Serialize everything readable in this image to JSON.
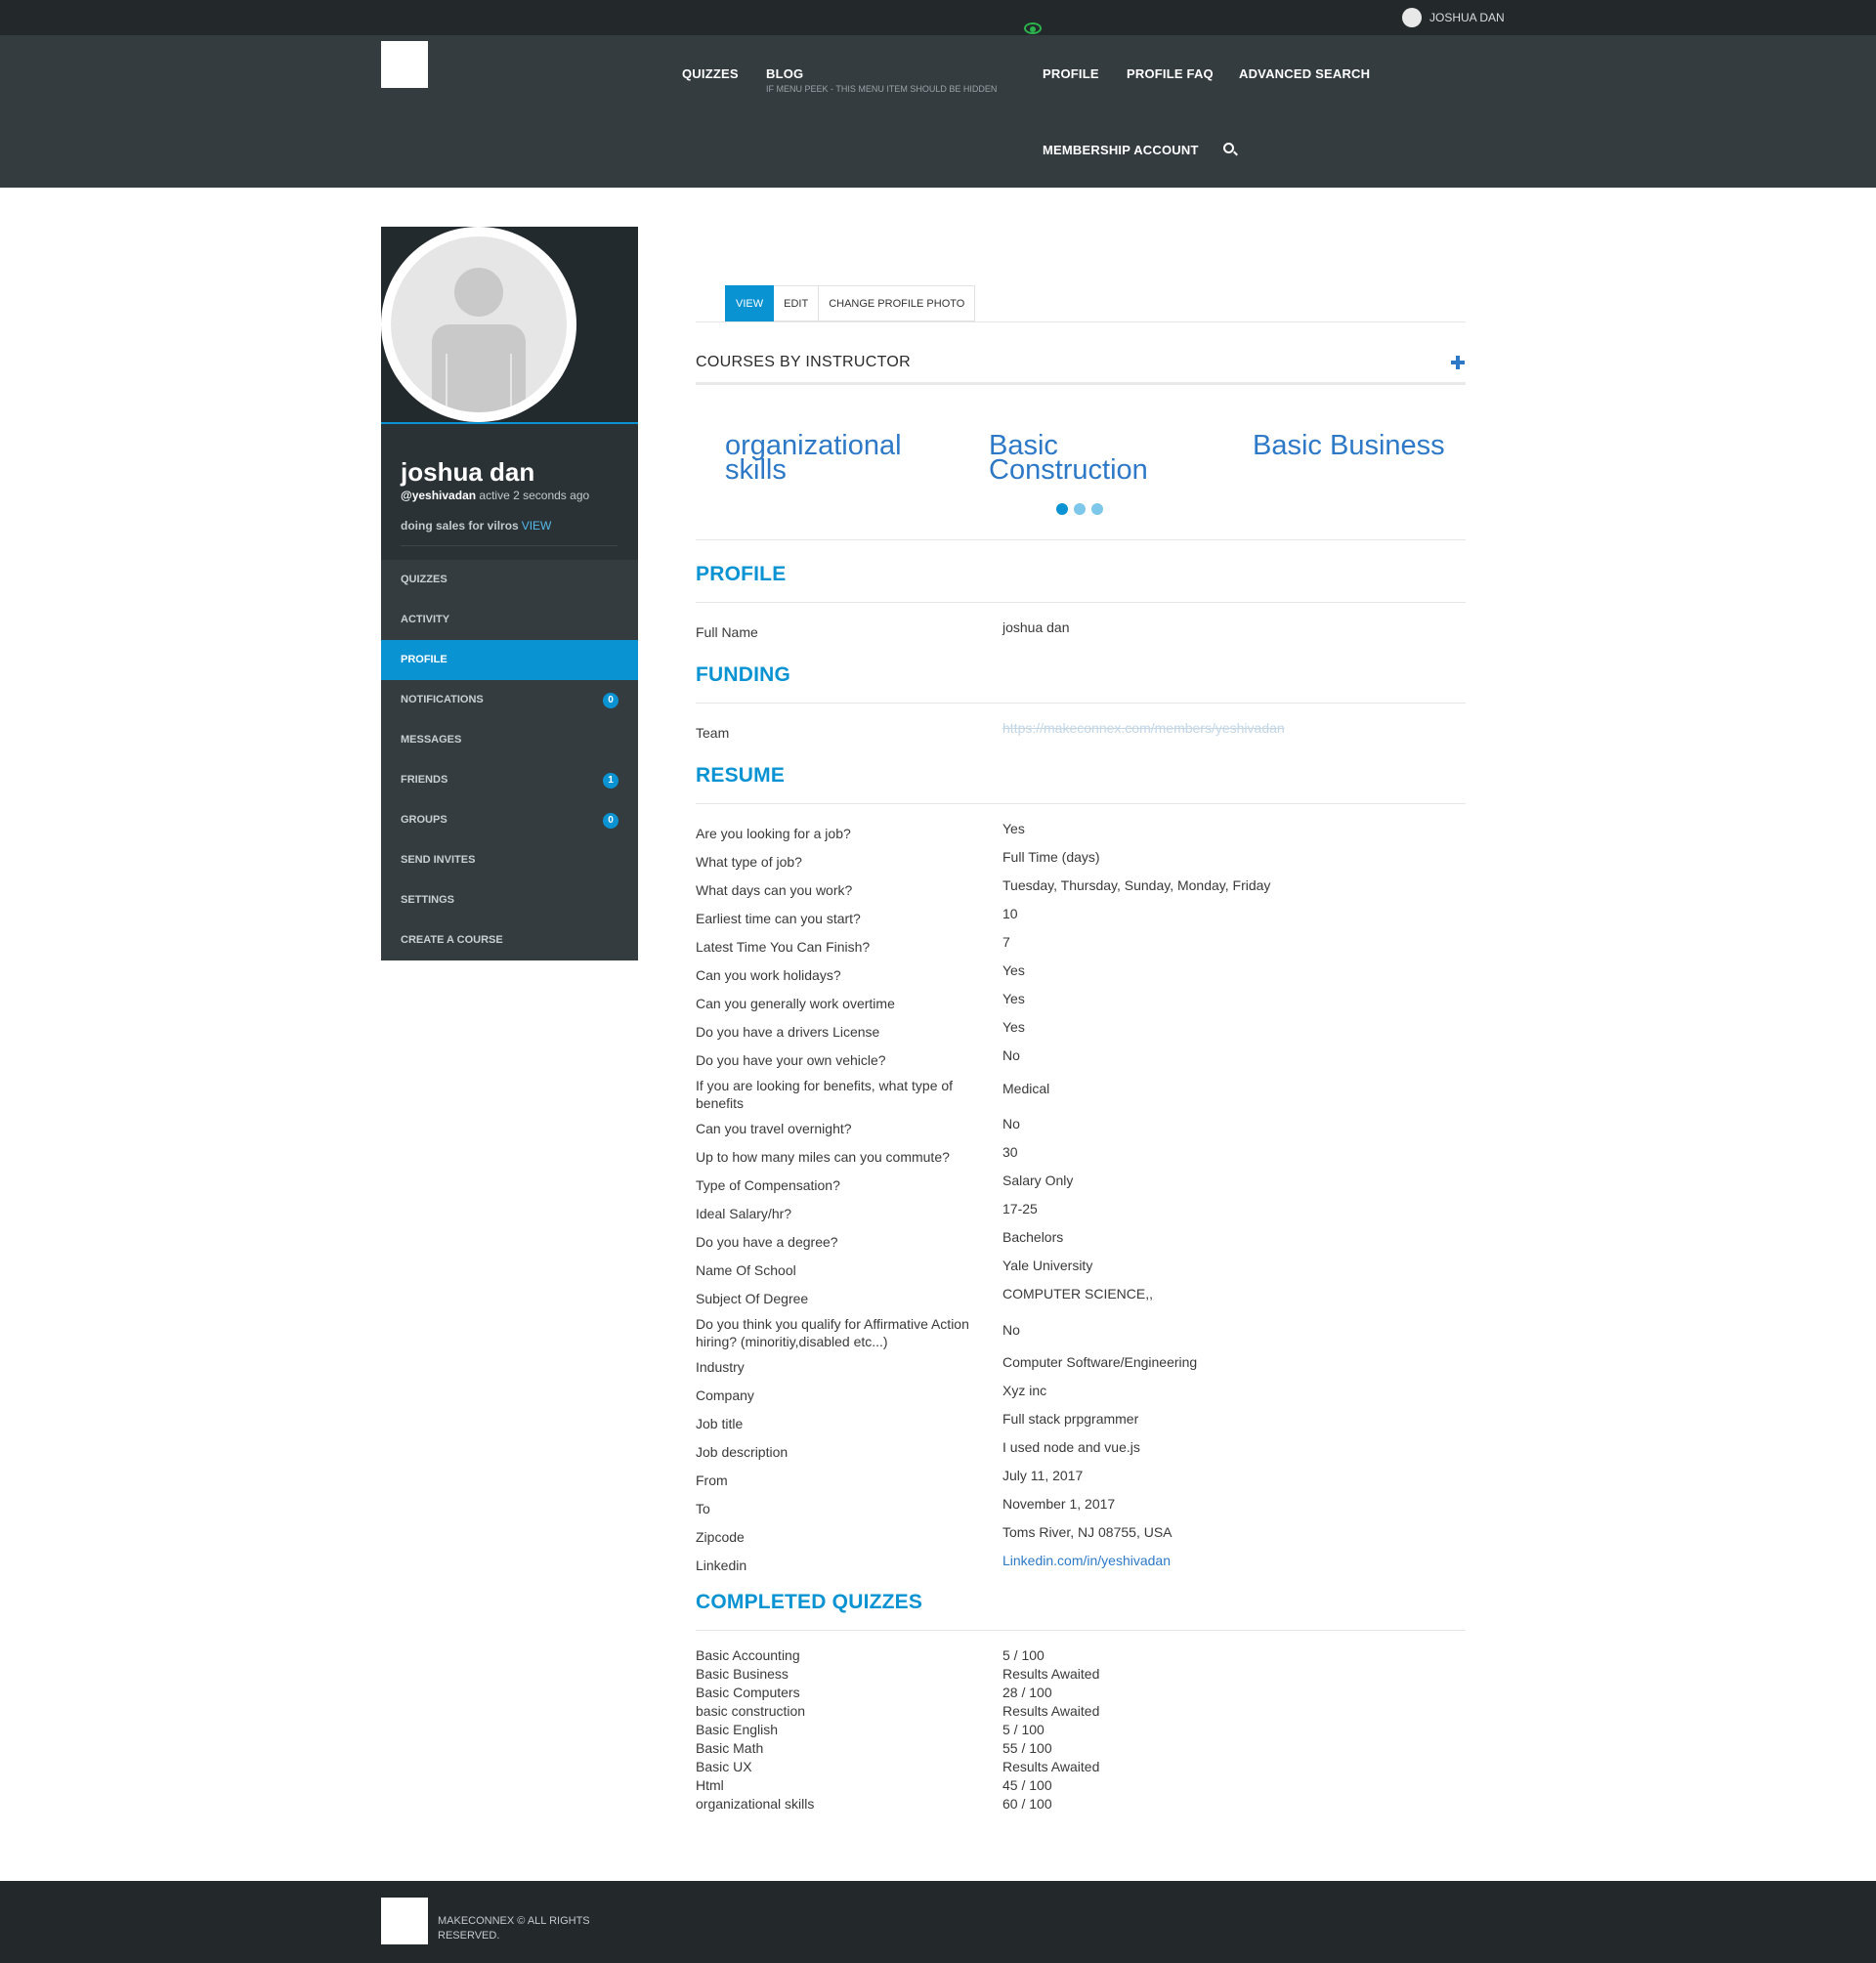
{
  "adminbar": {
    "user_name": "JOSHUA DAN"
  },
  "nav": {
    "quizzes": "QUIZZES",
    "blog": "BLOG",
    "blog_sub": "IF MENU PEEK - THIS MENU ITEM SHOULD BE HIDDEN",
    "profile": "PROFILE",
    "profile_faq": "PROFILE FAQ",
    "advanced_search": "ADVANCED SEARCH",
    "membership_account": "MEMBERSHIP ACCOUNT"
  },
  "user": {
    "name": "joshua dan",
    "handle": "@yeshivadan",
    "active": "active 2 seconds ago",
    "status": "doing sales for vilros",
    "status_view": "VIEW"
  },
  "menu": [
    {
      "label": "QUIZZES"
    },
    {
      "label": "ACTIVITY"
    },
    {
      "label": "PROFILE"
    },
    {
      "label": "NOTIFICATIONS",
      "badge": "0"
    },
    {
      "label": "MESSAGES"
    },
    {
      "label": "FRIENDS",
      "badge": "1"
    },
    {
      "label": "GROUPS",
      "badge": "0"
    },
    {
      "label": "SEND INVITES"
    },
    {
      "label": "SETTINGS"
    },
    {
      "label": "CREATE A COURSE"
    }
  ],
  "tabs": [
    "VIEW",
    "EDIT",
    "CHANGE PROFILE PHOTO"
  ],
  "courses": {
    "title": "COURSES BY INSTRUCTOR",
    "items": [
      "organizational skills",
      "Basic Construction",
      "Basic Business"
    ]
  },
  "sections": {
    "profile": "PROFILE",
    "funding": "FUNDING",
    "resume": "RESUME",
    "completed_quizzes": "COMPLETED QUIZZES"
  },
  "profile_fields": [
    {
      "label": "Full Name",
      "value": "joshua dan"
    }
  ],
  "funding_fields": [
    {
      "label": "Team",
      "value": "https://makeconnex.com/members/yeshivadan"
    }
  ],
  "resume_fields": [
    {
      "label": "Are you looking for a job?",
      "value": "Yes"
    },
    {
      "label": "What type of job?",
      "value": "Full Time (days)"
    },
    {
      "label": "What days can you work?",
      "value": "Tuesday, Thursday, Sunday, Monday, Friday"
    },
    {
      "label": "Earliest time can you start?",
      "value": "10"
    },
    {
      "label": "Latest Time You Can Finish?",
      "value": "7"
    },
    {
      "label": "Can you work holidays?",
      "value": "Yes"
    },
    {
      "label": "Can you generally work overtime",
      "value": "Yes"
    },
    {
      "label": "Do you have a drivers License",
      "value": "Yes"
    },
    {
      "label": "Do you have your own vehicle?",
      "value": "No"
    },
    {
      "label": "If you are looking for benefits, what type of benefits",
      "value": "Medical"
    },
    {
      "label": "Can you travel overnight?",
      "value": "No"
    },
    {
      "label": "Up to how many miles can you commute?",
      "value": "30"
    },
    {
      "label": "Type of Compensation?",
      "value": "Salary Only"
    },
    {
      "label": "Ideal Salary/hr?",
      "value": "17-25"
    },
    {
      "label": "Do you have a degree?",
      "value": "Bachelors"
    },
    {
      "label": "Name Of School",
      "value": "Yale University"
    },
    {
      "label": "Subject Of Degree",
      "value": "COMPUTER SCIENCE,,"
    },
    {
      "label": "Do you think you qualify for Affirmative Action hiring? (minoritiy,disabled etc...)",
      "value": "No"
    },
    {
      "label": "Industry",
      "value": "Computer Software/Engineering"
    },
    {
      "label": "Company",
      "value": "Xyz inc"
    },
    {
      "label": "Job title",
      "value": "Full stack prpgrammer"
    },
    {
      "label": "Job description",
      "value": "I used node and vue.js"
    },
    {
      "label": "From",
      "value": "July 11, 2017"
    },
    {
      "label": "To",
      "value": "November 1, 2017"
    },
    {
      "label": "Zipcode",
      "value": "Toms River, NJ 08755, USA"
    },
    {
      "label": "Linkedin",
      "value": "Linkedin.com/in/yeshivadan"
    }
  ],
  "quizzes": [
    {
      "name": "Basic Accounting",
      "score": "5 / 100"
    },
    {
      "name": "Basic Business",
      "score": "Results Awaited"
    },
    {
      "name": "Basic Computers",
      "score": "28 / 100"
    },
    {
      "name": "basic construction",
      "score": "Results Awaited"
    },
    {
      "name": "Basic English",
      "score": "5 / 100"
    },
    {
      "name": "Basic Math",
      "score": "55 / 100"
    },
    {
      "name": "Basic UX",
      "score": "Results Awaited"
    },
    {
      "name": "Html",
      "score": "45 / 100"
    },
    {
      "name": "organizational skills",
      "score": "60 / 100"
    }
  ],
  "footer": {
    "text": "MAKECONNEX © ALL RIGHTS RESERVED."
  },
  "colors": {
    "accent": "#0a93d3",
    "link": "#2d79c7",
    "header": "#343c40",
    "sidebar": "#2a3236",
    "eye": "#2bb24c"
  }
}
